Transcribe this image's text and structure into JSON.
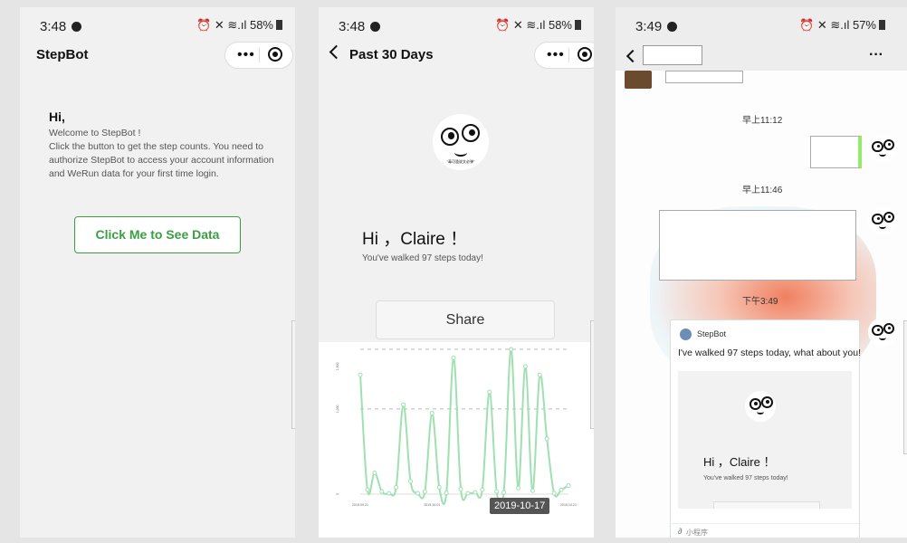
{
  "colors": {
    "green": "#3a9f44",
    "line": "#9fe0b0",
    "bubble_green": "#95ec69",
    "link_blue": "#576b95"
  },
  "screen1": {
    "status": {
      "time": "3:48",
      "battery": "58%",
      "icons": "⏰ ✕ ≋.ıl"
    },
    "title": "StepBot",
    "greeting": "Hi,",
    "welcome": "Welcome to StepBot !",
    "instructions": "Click the button to get the step counts. You need to authorize StepBot to access your account information and WeRun data for your first time login.",
    "button_label": "Click Me to See Data"
  },
  "screen2": {
    "status": {
      "time": "3:48",
      "battery": "58%",
      "icons": "⏰ ✕ ≋.ıl"
    },
    "title": "Past 30 Days",
    "mascot_caption": "\"毒可滥说文必弹\"",
    "hi": "Hi ，Claire ！",
    "steps_text": "You've walked 97 steps today!",
    "share_label": "Share",
    "tooltip": "2019-10-17"
  },
  "chart_data": {
    "type": "line",
    "title": "",
    "xlabel": "",
    "ylabel": "",
    "x": [
      1,
      2,
      3,
      4,
      5,
      6,
      7,
      8,
      9,
      10,
      11,
      12,
      13,
      14,
      15,
      16,
      17,
      18,
      19,
      20,
      21,
      22,
      23,
      24,
      25,
      26,
      27,
      28,
      29,
      30
    ],
    "series": [
      {
        "values": [
          1400,
          50,
          250,
          30,
          10,
          80,
          1050,
          150,
          10,
          30,
          950,
          80,
          15,
          1600,
          60,
          10,
          20,
          50,
          1200,
          30,
          20,
          1700,
          70,
          1500,
          40,
          1400,
          650,
          10,
          50,
          100
        ]
      }
    ],
    "ylim": [
      0,
      1700
    ],
    "grid": true,
    "tick_labels": {
      "x": [
        "2019-09-21",
        "2019-10-01",
        "2019-10-11",
        "2019-10-21"
      ],
      "y": [
        "0",
        "1,000",
        "1,500"
      ]
    }
  },
  "screen3": {
    "status": {
      "time": "3:49",
      "battery": "57%",
      "icons": "⏰ ✕ ≋.ıl"
    },
    "more": "···",
    "timestamps": [
      "早上11:12",
      "早上11:46",
      "下午3:49"
    ],
    "card": {
      "app_name": "StepBot",
      "message": "I've walked 97 steps today, what about you!",
      "hi": "Hi ，Claire ！",
      "steps_text": "You've walked 97 steps today!",
      "footer": "小程序"
    }
  }
}
